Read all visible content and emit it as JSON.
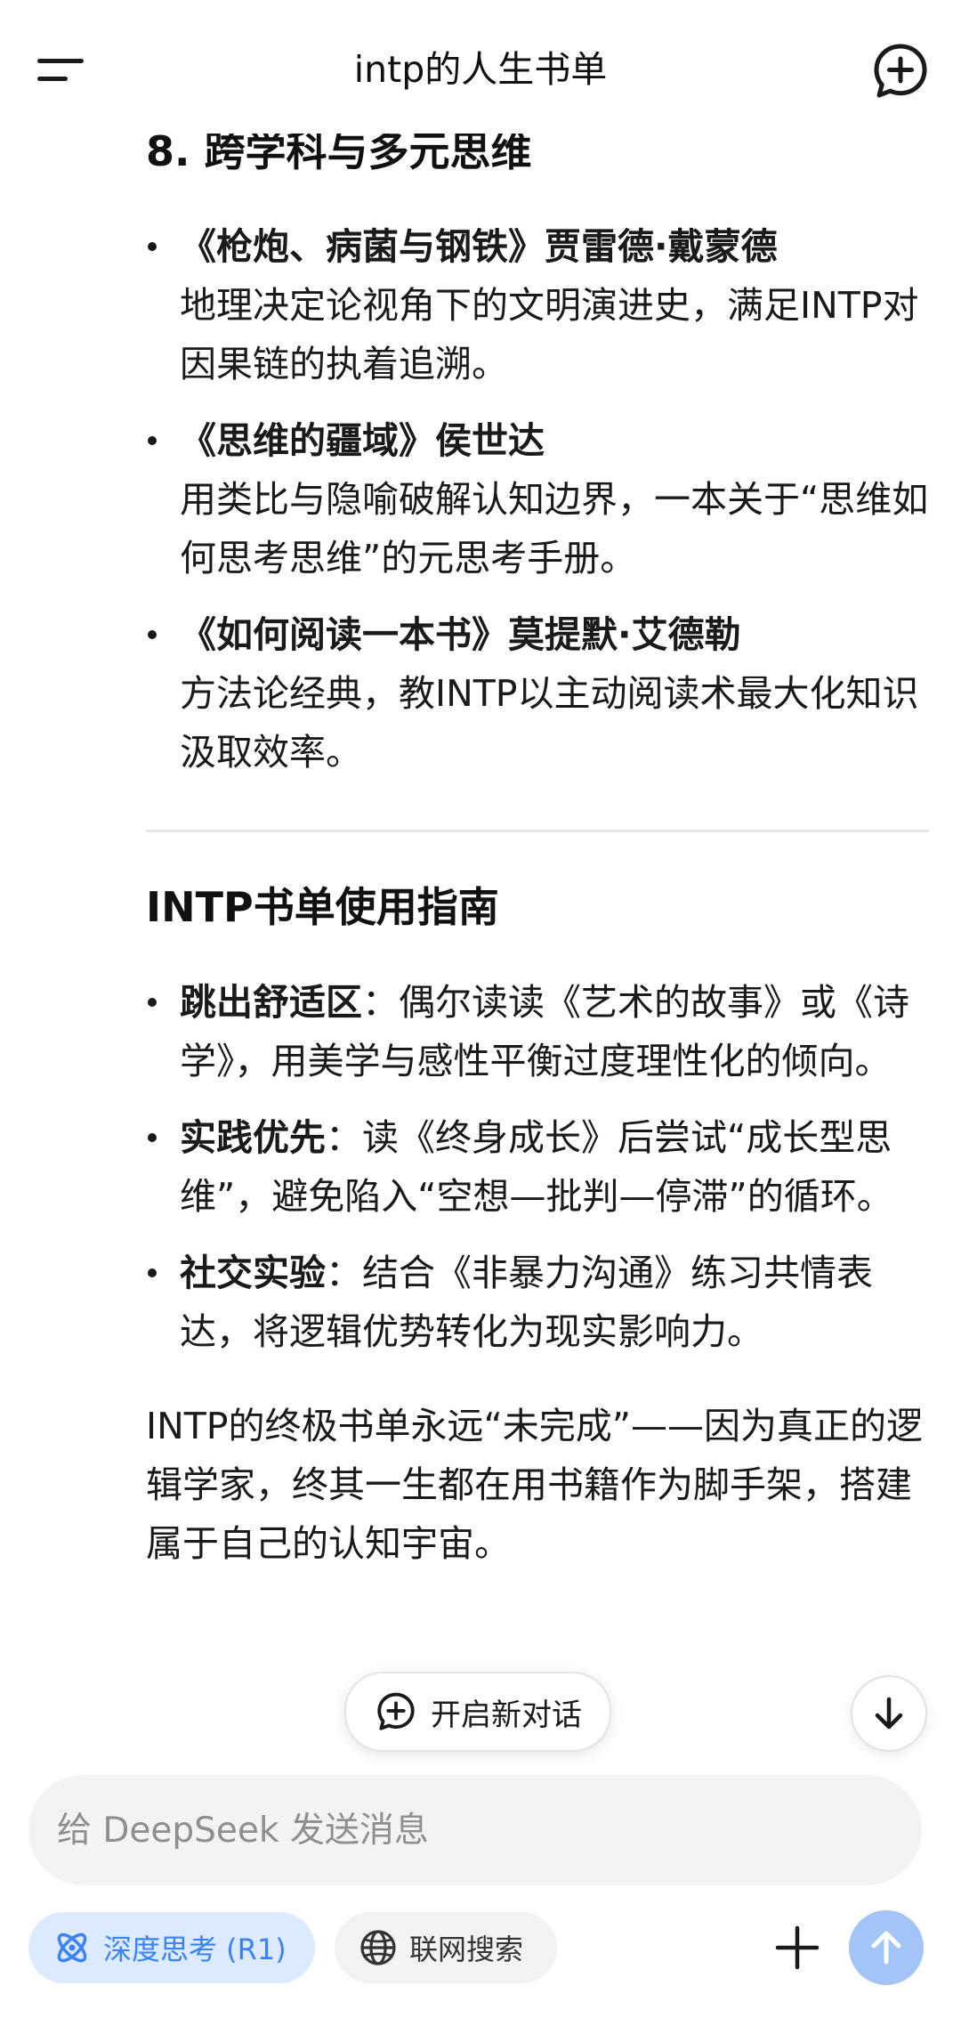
{
  "header": {
    "title": "intp的人生书单"
  },
  "section8": {
    "heading": "8. 跨学科与多元思维",
    "books": [
      {
        "title": "《枪炮、病菌与钢铁》贾雷德·戴蒙德",
        "desc": "地理决定论视角下的文明演进史，满足INTP对因果链的执着追溯。"
      },
      {
        "title": "《思维的疆域》侯世达",
        "desc": "用类比与隐喻破解认知边界，一本关于“思维如何思考思维”的元思考手册。"
      },
      {
        "title": "《如何阅读一本书》莫提默·艾德勒",
        "desc": "方法论经典，教INTP以主动阅读术最大化知识汲取效率。"
      }
    ]
  },
  "guide": {
    "heading": "INTP书单使用指南",
    "items": [
      {
        "label": "跳出舒适区",
        "text": "：偶尔读读《艺术的故事》或《诗学》，用美学与感性平衡过度理性化的倾向。"
      },
      {
        "label": "实践优先",
        "text": "：读《终身成长》后尝试“成长型思维”，避免陷入“空想—批判—停滞”的循环。"
      },
      {
        "label": "社交实验",
        "text": "：结合《非暴力沟通》练习共情表达，将逻辑优势转化为现实影响力。"
      }
    ],
    "closing": "INTP的终极书单永远“未完成”——因为真正的逻辑学家，终其一生都在用书籍作为脚手架，搭建属于自己的认知宇宙。"
  },
  "floating": {
    "new_chat_label": "开启新对话"
  },
  "composer": {
    "placeholder": "给 DeepSeek 发送消息",
    "deep_think_label": "深度思考 (R1)",
    "web_search_label": "联网搜索"
  },
  "icons": {
    "menu": "menu-icon",
    "new_chat": "new-chat-icon",
    "arrow_down": "arrow-down-icon",
    "atom": "atom-icon",
    "globe": "globe-icon",
    "plus": "plus-icon",
    "send": "arrow-up-icon"
  },
  "colors": {
    "accent": "#3b82f6",
    "accent_light": "#dbeafe",
    "send_disabled": "#a3c4f7",
    "input_bg": "#f2f3f5"
  }
}
